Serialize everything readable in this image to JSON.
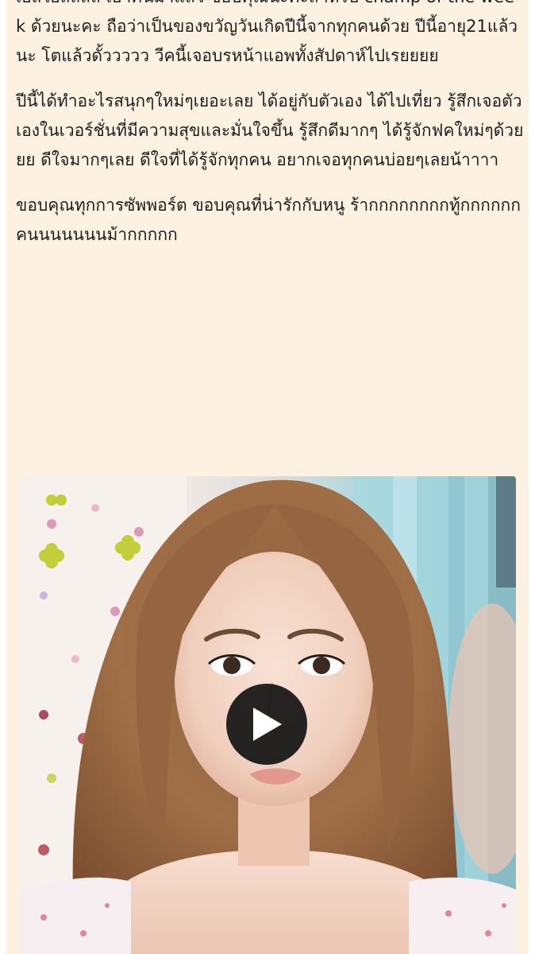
{
  "post": {
    "paragraphs": [
      "เอสไอสิสิสิสิ เอาคืนมาแล้ว ขอบคุณนะคะสำหรับ champ of the week ด้วยนะคะ ถือว่าเป็นของขวัญวันเกิดปีนี้จากทุกคนด้วย ปีนี้อายุ21แล้วนะ โตแล้วดั้ววววว วีคนี้เจอบรหน้าแอพทั้งสัปดาห์ไปเรยยยย",
      "ปีนี้ได้ทำอะไรสนุกๆใหม่ๆเยอะเลย ได้อยู่กับตัวเอง ได้ไปเที่ยว รู้สึกเจอตัวเองในเวอร์ชั่นที่มีความสุขและมั่นใจขึ้น รู้สึกดีมากๆ ได้รู้จักฟคใหม่ๆด้วยยย ดีใจมากๆเลย ดีใจที่ได้รู้จักทุกคน อยากเจอทุกคนบ่อยๆเลยน้าาาา",
      "ขอบคุณทุกการซัพพอร์ต ขอบคุณที่น่ารักกับหนู ร้ากกกกกกกกทู้กกกกกกคนนนนนนนม้ากกกกก"
    ]
  },
  "video": {
    "play_icon": "play-icon",
    "overlay_color": "#111111"
  }
}
